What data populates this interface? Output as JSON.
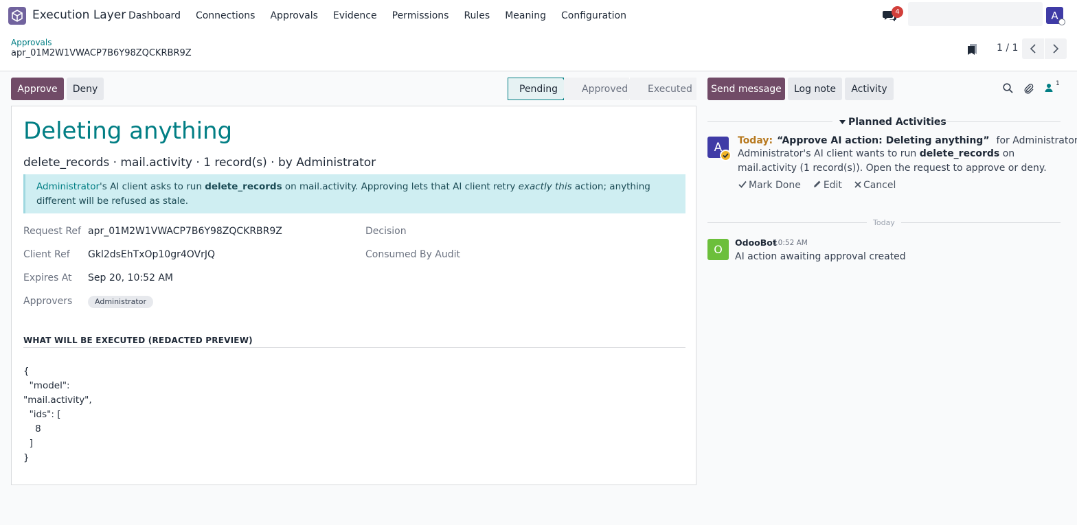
{
  "app": {
    "name": "Execution Layer"
  },
  "menu": [
    "Dashboard",
    "Connections",
    "Approvals",
    "Evidence",
    "Permissions",
    "Rules",
    "Meaning",
    "Configuration"
  ],
  "systray": {
    "chat_badge": "4",
    "avatar_letter": "A"
  },
  "breadcrumb": {
    "parent": "Approvals",
    "current": "apr_01M2W1VWACP7B6Y98ZQCKRBR9Z"
  },
  "pager": {
    "value": "1 / 1"
  },
  "actions": {
    "approve": "Approve",
    "deny": "Deny"
  },
  "stages": {
    "items": [
      "Pending",
      "Approved",
      "Executed"
    ],
    "active": "Pending"
  },
  "record": {
    "title": "Deleting anything",
    "subtitle": "delete_records · mail.activity · 1 record(s) · by Administrator",
    "info": {
      "user": "Administrator",
      "part1": "'s AI client asks to run ",
      "action": "delete_records",
      "part2": " on mail.activity. Approving lets that AI client retry ",
      "emphasis": "exactly this",
      "part3": " action; anything different will be refused as stale."
    },
    "fields": {
      "request_ref_label": "Request Ref",
      "request_ref_value": "apr_01M2W1VWACP7B6Y98ZQCKRBR9Z",
      "client_ref_label": "Client Ref",
      "client_ref_value": "Gkl2dsEhTxOp10gr4OVrJQ",
      "expires_label": "Expires At",
      "expires_value": "Sep 20, 10:52 AM",
      "approvers_label": "Approvers",
      "approvers_value": "Administrator",
      "decision_label": "Decision",
      "consumed_label": "Consumed By Audit"
    },
    "preview_title": "WHAT WILL BE EXECUTED (REDACTED PREVIEW)",
    "preview_code": "{\n  \"model\":\n\"mail.activity\",\n  \"ids\": [\n    8\n  ]\n}"
  },
  "chatter": {
    "send_message": "Send message",
    "log_note": "Log note",
    "activity": "Activity",
    "followers_count": "1",
    "planned_title": "Planned Activities",
    "activity_item": {
      "avatar_letter": "A",
      "due": "Today:",
      "summary": "“Approve AI action: Deleting anything”",
      "assignee": "for Administrator",
      "body_part1": "Administrator's AI client wants to run ",
      "body_bold": "delete_records",
      "body_part2": " on mail.activity (1 record(s)). Open the request to approve or deny.",
      "mark_done": "Mark Done",
      "edit": "Edit",
      "cancel": "Cancel"
    },
    "date_separator": "Today",
    "message": {
      "avatar_letter": "O",
      "author": "OdooBot",
      "time": "10:52 AM",
      "body": "AI action awaiting approval created"
    }
  },
  "colors": {
    "brand": "#714b67",
    "accent": "#017e84",
    "info_bg": "#cfeef2",
    "badge": "#d23f3a",
    "today": "#b7791f"
  }
}
